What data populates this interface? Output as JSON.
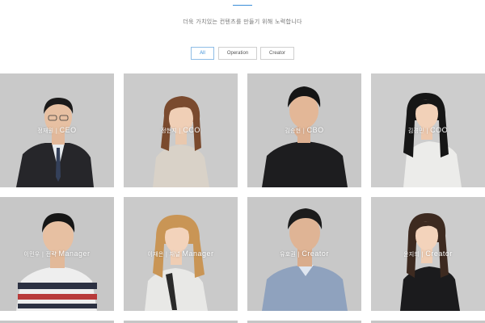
{
  "header": {
    "subtitle": "더욱 가치있는 컨텐츠를 만들기 위해 노력합니다"
  },
  "filters": [
    {
      "label": "All",
      "active": true
    },
    {
      "label": "Operation",
      "active": false
    },
    {
      "label": "Creator",
      "active": false
    }
  ],
  "team": [
    {
      "name": "정재원 |",
      "role": "CEO"
    },
    {
      "name": "정현지 |",
      "role": "CCO"
    },
    {
      "name": "김승현 |",
      "role": "CBO"
    },
    {
      "name": "김경민 |",
      "role": "COO"
    },
    {
      "name": "이민우 | 전략",
      "role": "Manager"
    },
    {
      "name": "이재은 | 채널",
      "role": "Manager"
    },
    {
      "name": "유호권 |",
      "role": "Creator"
    },
    {
      "name": "윤지희 |",
      "role": "Creator"
    }
  ],
  "colors": {
    "accent": "#3a8ed8",
    "card_bg": "#c6c6c6"
  }
}
